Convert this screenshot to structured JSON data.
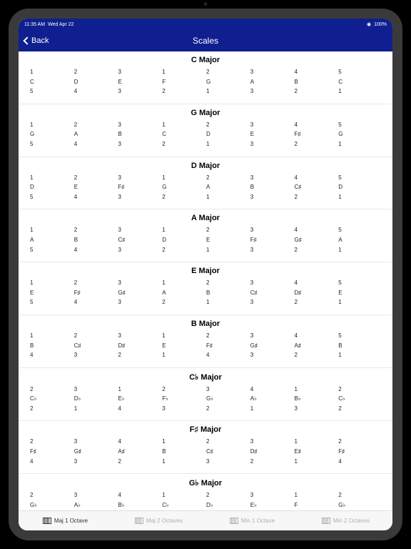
{
  "status": {
    "time": "11:35 AM",
    "date": "Wed Apr 22",
    "wifi": "wifi",
    "battery": "100%"
  },
  "nav": {
    "back": "Back",
    "title": "Scales"
  },
  "scales": [
    {
      "name": "C Major",
      "rows": [
        [
          "1",
          "2",
          "3",
          "1",
          "2",
          "3",
          "4",
          "5"
        ],
        [
          "C",
          "D",
          "E",
          "F",
          "G",
          "A",
          "B",
          "C"
        ],
        [
          "5",
          "4",
          "3",
          "2",
          "1",
          "3",
          "2",
          "1"
        ]
      ]
    },
    {
      "name": "G Major",
      "rows": [
        [
          "1",
          "2",
          "3",
          "1",
          "2",
          "3",
          "4",
          "5"
        ],
        [
          "G",
          "A",
          "B",
          "C",
          "D",
          "E",
          "F♯",
          "G"
        ],
        [
          "5",
          "4",
          "3",
          "2",
          "1",
          "3",
          "2",
          "1"
        ]
      ]
    },
    {
      "name": "D Major",
      "rows": [
        [
          "1",
          "2",
          "3",
          "1",
          "2",
          "3",
          "4",
          "5"
        ],
        [
          "D",
          "E",
          "F♯",
          "G",
          "A",
          "B",
          "C♯",
          "D"
        ],
        [
          "5",
          "4",
          "3",
          "2",
          "1",
          "3",
          "2",
          "1"
        ]
      ]
    },
    {
      "name": "A Major",
      "rows": [
        [
          "1",
          "2",
          "3",
          "1",
          "2",
          "3",
          "4",
          "5"
        ],
        [
          "A",
          "B",
          "C♯",
          "D",
          "E",
          "F♯",
          "G♯",
          "A"
        ],
        [
          "5",
          "4",
          "3",
          "2",
          "1",
          "3",
          "2",
          "1"
        ]
      ]
    },
    {
      "name": "E Major",
      "rows": [
        [
          "1",
          "2",
          "3",
          "1",
          "2",
          "3",
          "4",
          "5"
        ],
        [
          "E",
          "F♯",
          "G♯",
          "A",
          "B",
          "C♯",
          "D♯",
          "E"
        ],
        [
          "5",
          "4",
          "3",
          "2",
          "1",
          "3",
          "2",
          "1"
        ]
      ]
    },
    {
      "name": "B Major",
      "rows": [
        [
          "1",
          "2",
          "3",
          "1",
          "2",
          "3",
          "4",
          "5"
        ],
        [
          "B",
          "C♯",
          "D♯",
          "E",
          "F♯",
          "G♯",
          "A♯",
          "B"
        ],
        [
          "4",
          "3",
          "2",
          "1",
          "4",
          "3",
          "2",
          "1"
        ]
      ]
    },
    {
      "name": "C♭ Major",
      "rows": [
        [
          "2",
          "3",
          "1",
          "2",
          "3",
          "4",
          "1",
          "2"
        ],
        [
          "C♭",
          "D♭",
          "E♭",
          "F♭",
          "G♭",
          "A♭",
          "B♭",
          "C♭"
        ],
        [
          "2",
          "1",
          "4",
          "3",
          "2",
          "1",
          "3",
          "2"
        ]
      ]
    },
    {
      "name": "F♯ Major",
      "rows": [
        [
          "2",
          "3",
          "4",
          "1",
          "2",
          "3",
          "1",
          "2"
        ],
        [
          "F♯",
          "G♯",
          "A♯",
          "B",
          "C♯",
          "D♯",
          "E♯",
          "F♯"
        ],
        [
          "4",
          "3",
          "2",
          "1",
          "3",
          "2",
          "1",
          "4"
        ]
      ]
    },
    {
      "name": "G♭ Major",
      "rows": [
        [
          "2",
          "3",
          "4",
          "1",
          "2",
          "3",
          "1",
          "2"
        ],
        [
          "G♭",
          "A♭",
          "B♭",
          "C♭",
          "D♭",
          "E♭",
          "F",
          "G♭"
        ]
      ]
    }
  ],
  "tabs": [
    {
      "label": "Maj 1 Octave",
      "active": true
    },
    {
      "label": "Maj 2 Octaves",
      "active": false
    },
    {
      "label": "Min 1 Octave",
      "active": false
    },
    {
      "label": "Min 2 Octaves",
      "active": false
    }
  ]
}
